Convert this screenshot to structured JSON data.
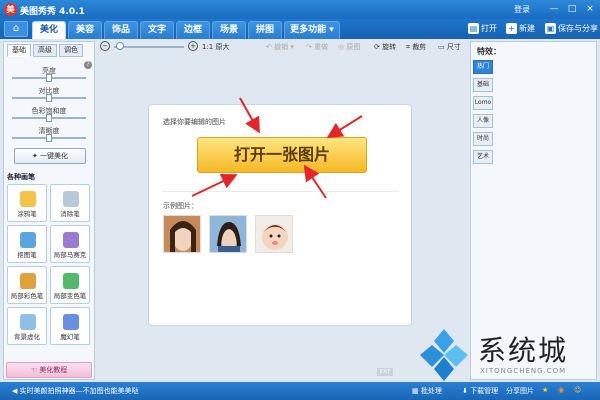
{
  "window": {
    "logo": "美",
    "title": "美图秀秀 4.0.1",
    "login": "登录",
    "minimize": "—",
    "maximize": "□",
    "close": "×"
  },
  "tabs": [
    {
      "label": "美化",
      "active": true
    },
    {
      "label": "美容",
      "active": false
    },
    {
      "label": "饰品",
      "active": false
    },
    {
      "label": "文字",
      "active": false
    },
    {
      "label": "边框",
      "active": false
    },
    {
      "label": "场景",
      "active": false
    },
    {
      "label": "拼图",
      "active": false
    },
    {
      "label": "更多功能 ▾",
      "active": false
    }
  ],
  "top_actions": {
    "open": "打开",
    "new": "新建",
    "save_share": "保存与分享"
  },
  "left_panel": {
    "subtabs": [
      "基础",
      "高级",
      "调色"
    ],
    "sliders": [
      {
        "label": "亮度",
        "level": 0.5
      },
      {
        "label": "对比度",
        "level": 0.5
      },
      {
        "label": "色彩饱和度",
        "level": 0.5
      },
      {
        "label": "清晰度",
        "level": 0.5
      }
    ],
    "onekey_label": "一键美化",
    "section_title": "各种画笔",
    "tools": [
      {
        "label": "涂鸦笔",
        "badge": "",
        "color": "#f3c34a"
      },
      {
        "label": "消除笔",
        "badge": "",
        "color": "#b7c8d8"
      },
      {
        "label": "抠图笔",
        "badge": "",
        "color": "#5aa5df"
      },
      {
        "label": "局部马赛克",
        "badge": "",
        "color": "#9a7bd0"
      },
      {
        "label": "局部彩色笔",
        "badge": "",
        "color": "#e0a13b"
      },
      {
        "label": "局部变色笔",
        "badge": "",
        "color": "#52b86a"
      },
      {
        "label": "背景虚化",
        "badge": "",
        "color": "#8dc0e4"
      },
      {
        "label": "魔幻笔",
        "badge": "",
        "color": "#6a8ee0"
      }
    ],
    "tutorial_label": "美化教程"
  },
  "toolbar2": {
    "ratio": "1:1 原大",
    "rotate_left": "撤销",
    "redo": "重做",
    "original": "原图",
    "rotate": "旋转",
    "crop": "裁剪",
    "size": "尺寸"
  },
  "card": {
    "hint": "选择你要编辑的图片",
    "open_button": "打开一张图片",
    "sample_label": "示例图片："
  },
  "right_panel": {
    "title": "特效：",
    "categories": [
      {
        "label": "热门",
        "active": true
      },
      {
        "label": "基础",
        "active": false
      },
      {
        "label": "Lomo",
        "active": false
      },
      {
        "label": "人像",
        "active": false
      },
      {
        "label": "时尚",
        "active": false
      },
      {
        "label": "艺术",
        "active": false
      }
    ]
  },
  "brand": {
    "name": "系统城",
    "sub": "XITONGCHENG.COM"
  },
  "status": {
    "text": "实时美颜拍照神器—不加图也能美美哒",
    "batch": "批处理",
    "download": "下载管理",
    "share": "分享图片"
  },
  "colors": {
    "title_blue": "#1a6cc0",
    "button_gold": "#f6b826",
    "arrow_red": "#e3262a"
  }
}
